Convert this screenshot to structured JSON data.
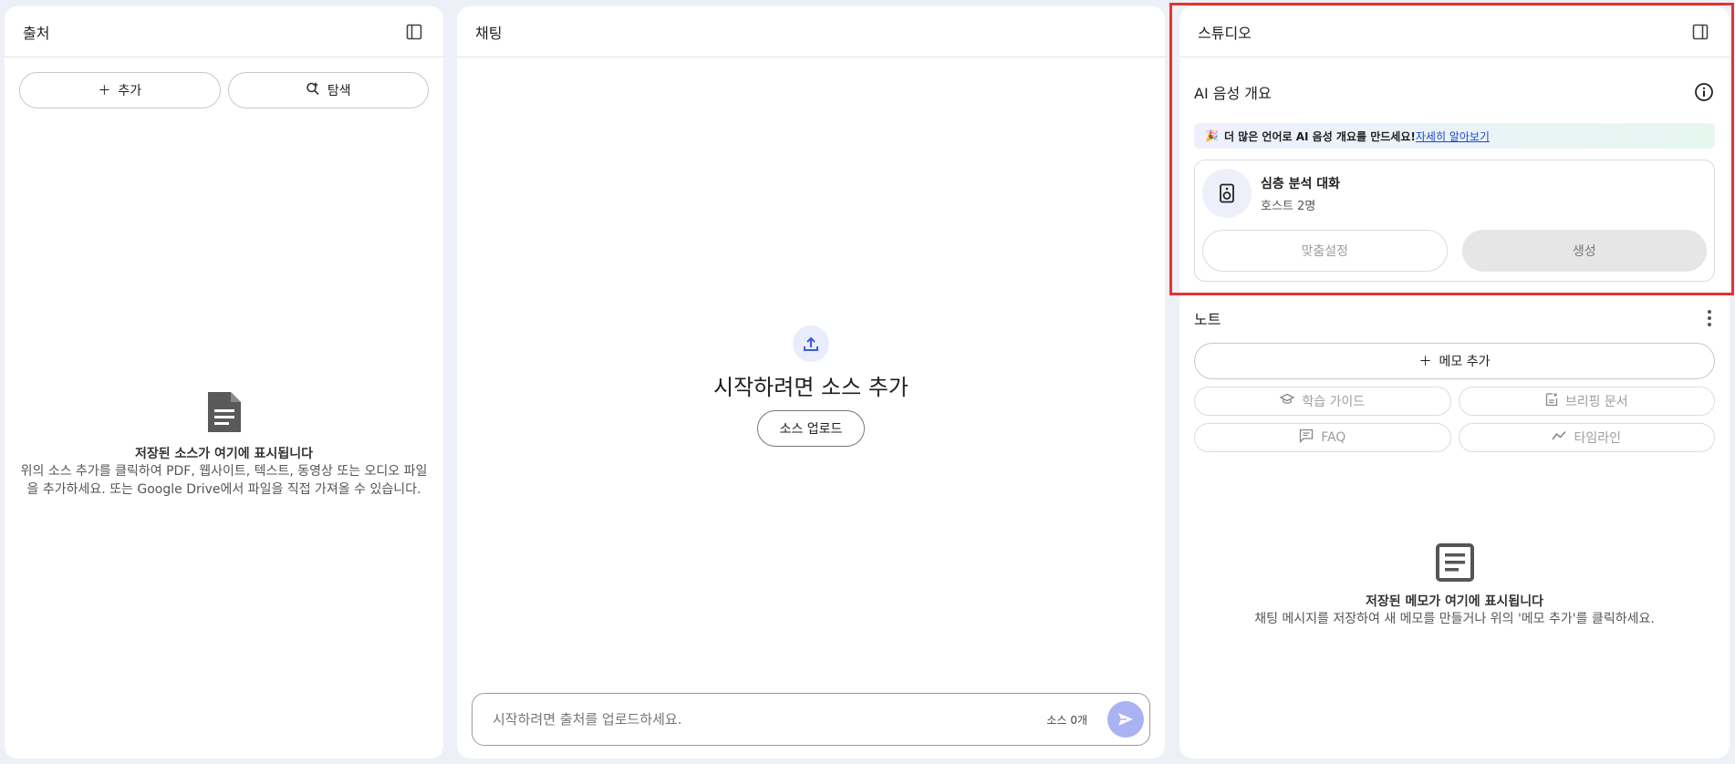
{
  "sources": {
    "title": "출처",
    "add_label": "추가",
    "explore_label": "탐색",
    "empty_title": "저장된 소스가 여기에 표시됩니다",
    "empty_desc": "위의 소스 추가를 클릭하여 PDF, 웹사이트, 텍스트, 동영상 또는 오디오 파일을 추가하세요. 또는 Google Drive에서 파일을 직접 가져올 수 있습니다."
  },
  "chat": {
    "title": "채팅",
    "heading": "시작하려면 소스 추가",
    "upload_label": "소스 업로드",
    "input_placeholder": "시작하려면 출처를 업로드하세요.",
    "source_count": "소스 0개"
  },
  "studio": {
    "title": "스튜디오",
    "audio_section_title": "AI 음성 개요",
    "banner_emoji": "🎉",
    "banner_text": "더 많은 언어로 AI 음성 개요를 만드세요!",
    "banner_link": "자세히 알아보기",
    "audio_card_title": "심층 분석 대화",
    "audio_card_sub": "호스트 2명",
    "customize_label": "맞춤설정",
    "generate_label": "생성",
    "notes_title": "노트",
    "add_note_label": "메모 추가",
    "study_guide_label": "학습 가이드",
    "briefing_label": "브리핑 문서",
    "faq_label": "FAQ",
    "timeline_label": "타임라인",
    "notes_empty_title": "저장된 메모가 여기에 표시됩니다",
    "notes_empty_desc": "채팅 메시지를 저장하여 새 메모를 만들거나 위의 '메모 추가'를 클릭하세요."
  },
  "colors": {
    "background": "#eef0f8",
    "accent": "#1a47d9",
    "send_button": "#a9b2f3",
    "highlight": "#e3342f"
  }
}
